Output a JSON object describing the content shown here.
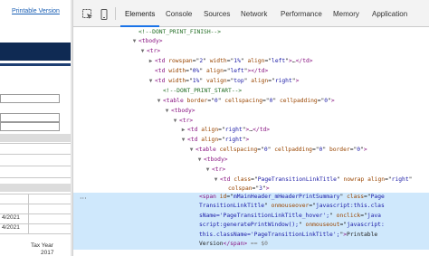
{
  "page": {
    "printable_link": "Printable Version",
    "dates": [
      "4/2021",
      "4/2021"
    ],
    "tax_year_label": "Tax Year",
    "tax_year_value": "2017"
  },
  "devtools": {
    "tabs": [
      "Elements",
      "Console",
      "Sources",
      "Network",
      "Performance",
      "Memory",
      "Application"
    ],
    "active_tab": "Elements",
    "icons": [
      "inspect-element-icon",
      "device-toolbar-icon"
    ]
  },
  "tree": {
    "comment_finish": "<!--DONT_PRINT_FINISH-->",
    "tbody": "tbody",
    "tr": "tr",
    "td": "td",
    "table": "table",
    "ellipsis": "…",
    "comment_start": "<!--DONT_PRINT_START-->",
    "rowspan_attr": "rowspan",
    "rowspan_val": "2",
    "width_attr": "width",
    "width_1pct": "1%",
    "width_0pct": "0%",
    "align_attr": "align",
    "align_left": "left",
    "align_right": "right",
    "valign_attr": "valign",
    "valign_top": "top",
    "border_attr": "border",
    "border_val": "0",
    "cellspacing_attr": "cellspacing",
    "cellspacing_val": "0",
    "cellpadding_attr": "cellpadding",
    "cellpadding_val": "0",
    "class_attr": "class",
    "class_val": "PageTransitionLinkTitle",
    "nowrap_attr": "nowrap",
    "colspan_attr": "colspan",
    "colspan_val": "3",
    "span_tag": "span",
    "span_id_attr": "id",
    "span_id_val": "mMainHeader_mHeaderPrintSummary",
    "span_class_attr": "class",
    "span_class_val_1": "Page",
    "span_class_val_2": "TransitionLinkTitle",
    "onmouseover_attr": "onmouseover",
    "onmouseover_val_1": "javascript:this.clas",
    "onmouseover_val_2": "sName='PageTransitionLinkTitle_hover';",
    "onclick_attr": "onclick",
    "onclick_val_1": "java",
    "onclick_val_2": "script:generatePrintWindow();",
    "onmouseout_attr": "onmouseout",
    "onmouseout_val_1": "javascript:",
    "onmouseout_val_2": "this.className='PageTransitionLinkTitle';",
    "span_text_1": "Printable",
    "span_text_2": "Version",
    "eq_dollar": "== $0"
  }
}
